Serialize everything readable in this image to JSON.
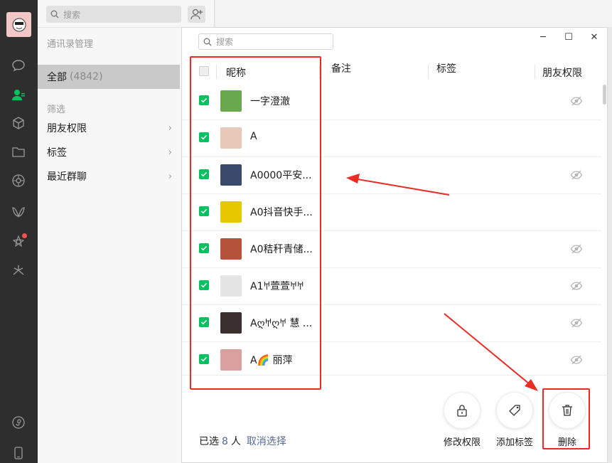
{
  "sidebar": {
    "icons": [
      "chat-icon",
      "contacts-icon",
      "cube-icon",
      "folder-icon",
      "moments-icon",
      "channels-icon",
      "search-mini-program-icon",
      "look-icon",
      "mini-program-icon",
      "phone-icon"
    ]
  },
  "middle": {
    "search_placeholder": "搜索",
    "title": "通讯录管理",
    "all_label": "全部",
    "all_count": "(4842)",
    "filter_label": "筛选",
    "filters": [
      "朋友权限",
      "标签",
      "最近群聊"
    ]
  },
  "dialog": {
    "search_placeholder": "搜索",
    "window_buttons": [
      "─",
      "☐",
      "✕"
    ],
    "columns": [
      "昵称",
      "备注",
      "标签",
      "朋友权限"
    ],
    "rows": [
      {
        "name": "一字澄澈",
        "avatar_color": "#6aa84f",
        "restricted": true
      },
      {
        "name": "A",
        "avatar_color": "#e8c9b9",
        "restricted": false
      },
      {
        "name": "A0000平安...",
        "avatar_color": "#3a4a6b",
        "restricted": true
      },
      {
        "name": "A0抖音快手...",
        "avatar_color": "#e6c800",
        "restricted": false
      },
      {
        "name": "A0秸秆青储...",
        "avatar_color": "#b5523b",
        "restricted": true
      },
      {
        "name": "A1𐀀萱萱𐀀𐀀",
        "avatar_color": "#e5e5e5",
        "restricted": true
      },
      {
        "name": "Aღ𐀀ღ𐀀  慧 ...",
        "avatar_color": "#3b2f2f",
        "restricted": true
      },
      {
        "name": "A🌈 丽萍",
        "avatar_color": "#d9a0a0",
        "restricted": true
      }
    ],
    "selected_prefix": "已选",
    "selected_count": "8",
    "selected_suffix": "人",
    "cancel_selection": "取消选择",
    "actions": [
      "修改权限",
      "添加标签",
      "删除"
    ]
  },
  "colors": {
    "check_green": "#07c160",
    "link_blue": "#576b95",
    "annotation_red": "#ee2a24"
  }
}
